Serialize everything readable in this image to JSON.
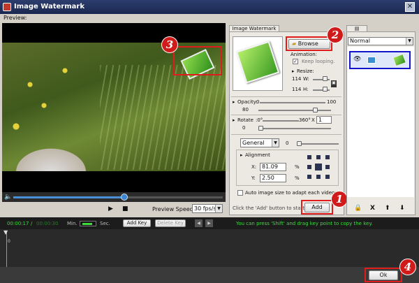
{
  "window": {
    "title": "Image Watermark",
    "close_label": "✕"
  },
  "preview": {
    "label": "Preview:"
  },
  "player": {
    "progress": 0.53,
    "play_icon": "▶",
    "stop_icon": "■",
    "preview_speed_label": "Preview Speed",
    "preview_speed_value": "30 fps/s",
    "volume_icon": "🔈"
  },
  "watermark_tab": {
    "label": "Image Watermark",
    "browse_label": "Browse",
    "animation_label": "Animation:",
    "keep_looping_label": "Keep looping.",
    "keep_looping_checked": true,
    "resize_label": "Resize:",
    "width_value": "114",
    "width_label": "W:",
    "height_value": "114",
    "height_label": "H:",
    "opacity_label": "Opacity:",
    "opacity_min": "0",
    "opacity_max": "100",
    "opacity_value": "80",
    "opacity_level": 0.8,
    "rotate_label": "Rotate",
    "rotate_min": ":0°",
    "rotate_max": "360°",
    "rotate_times": "X",
    "rotate_count": "1",
    "rotate_value": "0",
    "rotate_level": 0.0,
    "blend_mode": "General",
    "blend_value": "0",
    "blend_level": 0.0,
    "alignment_label": "Alignment",
    "x_label": "X:",
    "x_value": "81.09",
    "y_label": "Y:",
    "y_value": "2.50",
    "percent": "%",
    "auto_size_label": "Auto image size to adapt each videos.",
    "auto_size_checked": false,
    "hint_label": "Click the 'Add' button to start ->",
    "add_label": "Add"
  },
  "layers_tab": {
    "blend_select": "Normal",
    "tab_icon": "layers-icon",
    "eye_icon": "👁",
    "toolbar": {
      "lock": "🔒",
      "delete": "X",
      "up": "⬆",
      "down": "⬇"
    }
  },
  "timeline": {
    "current_time": "00:00:17",
    "separator": "/",
    "total_time": "00:00:30",
    "min_label": "Min.",
    "sec_label": "Sec.",
    "add_key_label": "Add Key",
    "delete_key_label": "Delete Key",
    "prev_icon": "◀",
    "next_icon": "▶",
    "hint": "You can press 'Shift' and drag key point to copy the key.",
    "marker_label": "0"
  },
  "footer": {
    "ok_label": "Ok"
  },
  "annotations": {
    "one": "1",
    "two": "2",
    "three": "3",
    "four": "4"
  },
  "colors": {
    "highlight_red": "#e01b1b",
    "selection_blue": "#1414c8",
    "time_green": "#3ddc3d"
  }
}
